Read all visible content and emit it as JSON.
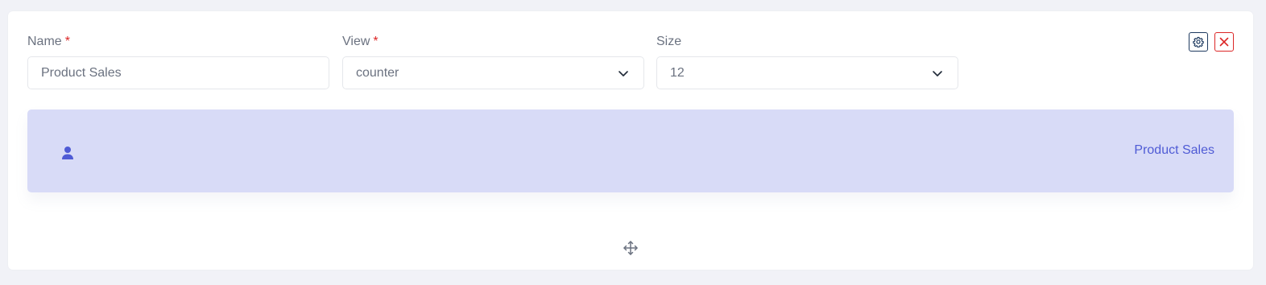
{
  "form": {
    "name": {
      "label": "Name",
      "required_mark": "*",
      "value": "Product Sales"
    },
    "view": {
      "label": "View",
      "required_mark": "*",
      "value": "counter"
    },
    "size": {
      "label": "Size",
      "value": "12"
    }
  },
  "actions": {
    "settings_icon": "gear-icon",
    "close_icon": "close-icon"
  },
  "widget": {
    "icon": "user-icon",
    "title": "Product Sales",
    "background_color": "#d8dbf7",
    "accent_color": "#4f5bd5"
  },
  "move_handle_icon": "move-icon"
}
